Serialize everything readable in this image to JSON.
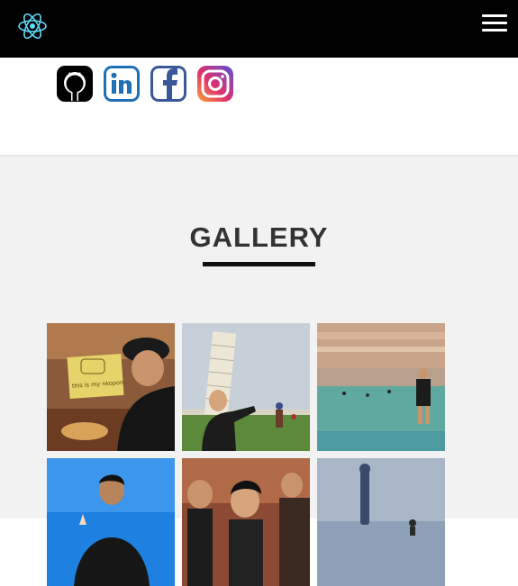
{
  "navbar": {
    "logo_icon": "react-atom-icon",
    "menu_icon": "hamburger-menu-icon"
  },
  "social": [
    {
      "name": "github-icon",
      "color": "#000000"
    },
    {
      "name": "linkedin-icon",
      "color": "#1f6fb5"
    },
    {
      "name": "facebook-icon",
      "color": "#3b5998"
    },
    {
      "name": "instagram-icon",
      "color": "#e1306c"
    }
  ],
  "gallery": {
    "title": "GALLERY",
    "photo_note": "this is my nkopon"
  },
  "colors": {
    "navbar_bg": "#000000",
    "react_blue": "#61dafb",
    "gallery_bg": "#f2f2f2"
  }
}
